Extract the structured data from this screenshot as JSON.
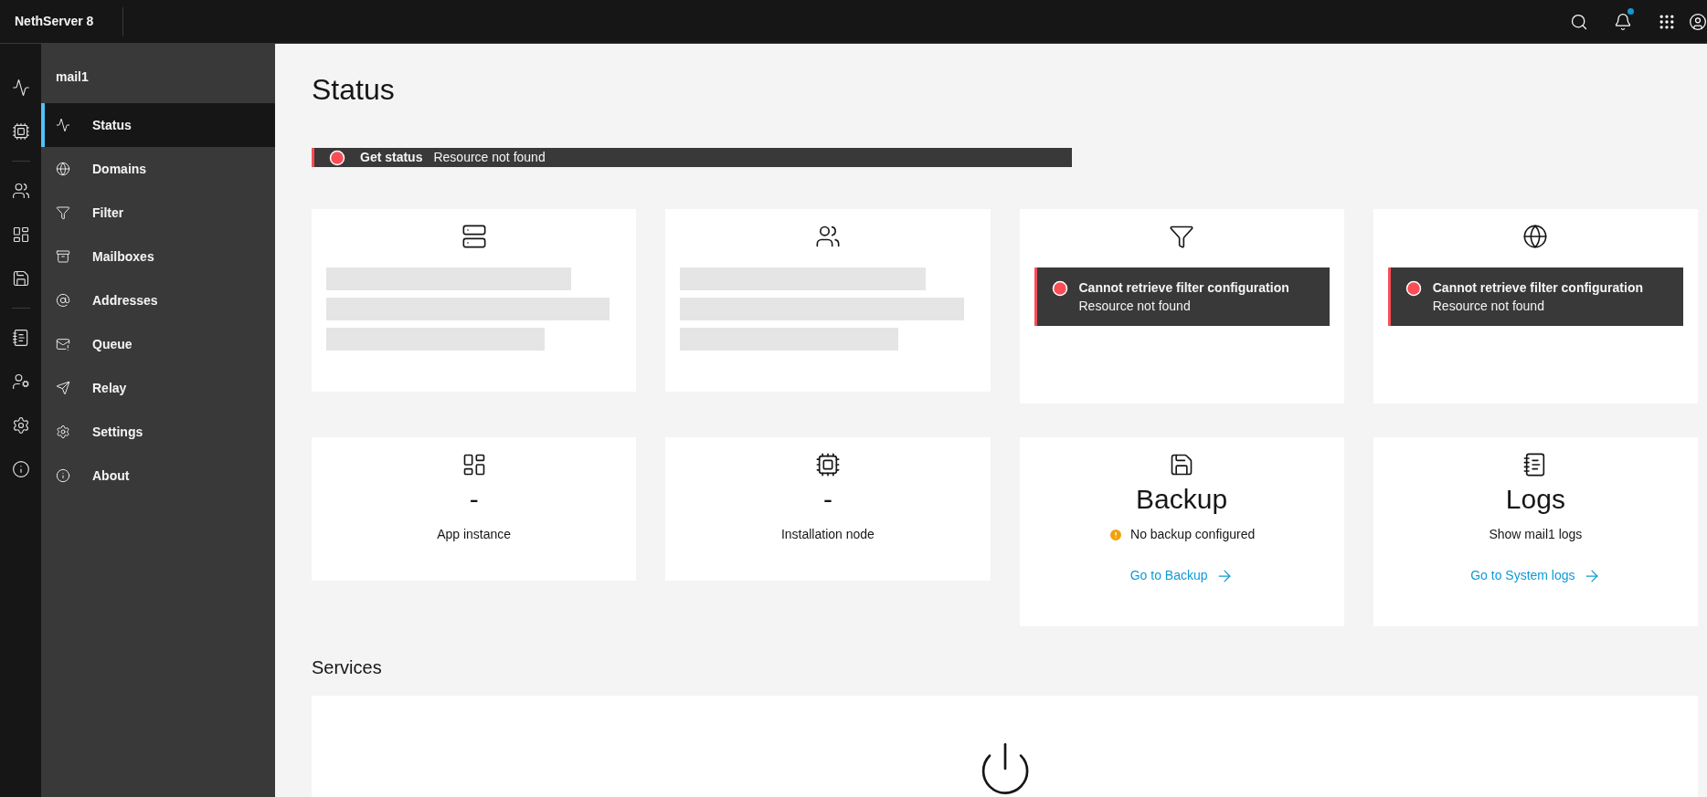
{
  "topbar": {
    "brand": "NethServer 8",
    "notifications": {
      "unread": true
    }
  },
  "sidebar": {
    "title": "mail1",
    "items": [
      {
        "label": "Status",
        "selected": true
      },
      {
        "label": "Domains",
        "selected": false
      },
      {
        "label": "Filter",
        "selected": false
      },
      {
        "label": "Mailboxes",
        "selected": false
      },
      {
        "label": "Addresses",
        "selected": false
      },
      {
        "label": "Queue",
        "selected": false
      },
      {
        "label": "Relay",
        "selected": false
      },
      {
        "label": "Settings",
        "selected": false
      },
      {
        "label": "About",
        "selected": false
      }
    ]
  },
  "page": {
    "title": "Status"
  },
  "alert": {
    "title": "Get status",
    "message": "Resource not found"
  },
  "cards": [
    {
      "kind": "loading"
    },
    {
      "kind": "loading"
    },
    {
      "kind": "error",
      "title": "Cannot retrieve filter configuration",
      "message": "Resource not found"
    },
    {
      "kind": "error",
      "title": "Cannot retrieve filter configuration",
      "message": "Resource not found"
    },
    {
      "kind": "info",
      "value": "-",
      "label": "App instance"
    },
    {
      "kind": "info",
      "value": "-",
      "label": "Installation node"
    },
    {
      "kind": "link",
      "title": "Backup",
      "note": "No backup configured",
      "warning": true,
      "link": "Go to Backup"
    },
    {
      "kind": "link",
      "title": "Logs",
      "note": "Show mail1 logs",
      "warning": false,
      "link": "Go to System logs"
    }
  ],
  "services": {
    "title": "Services"
  }
}
